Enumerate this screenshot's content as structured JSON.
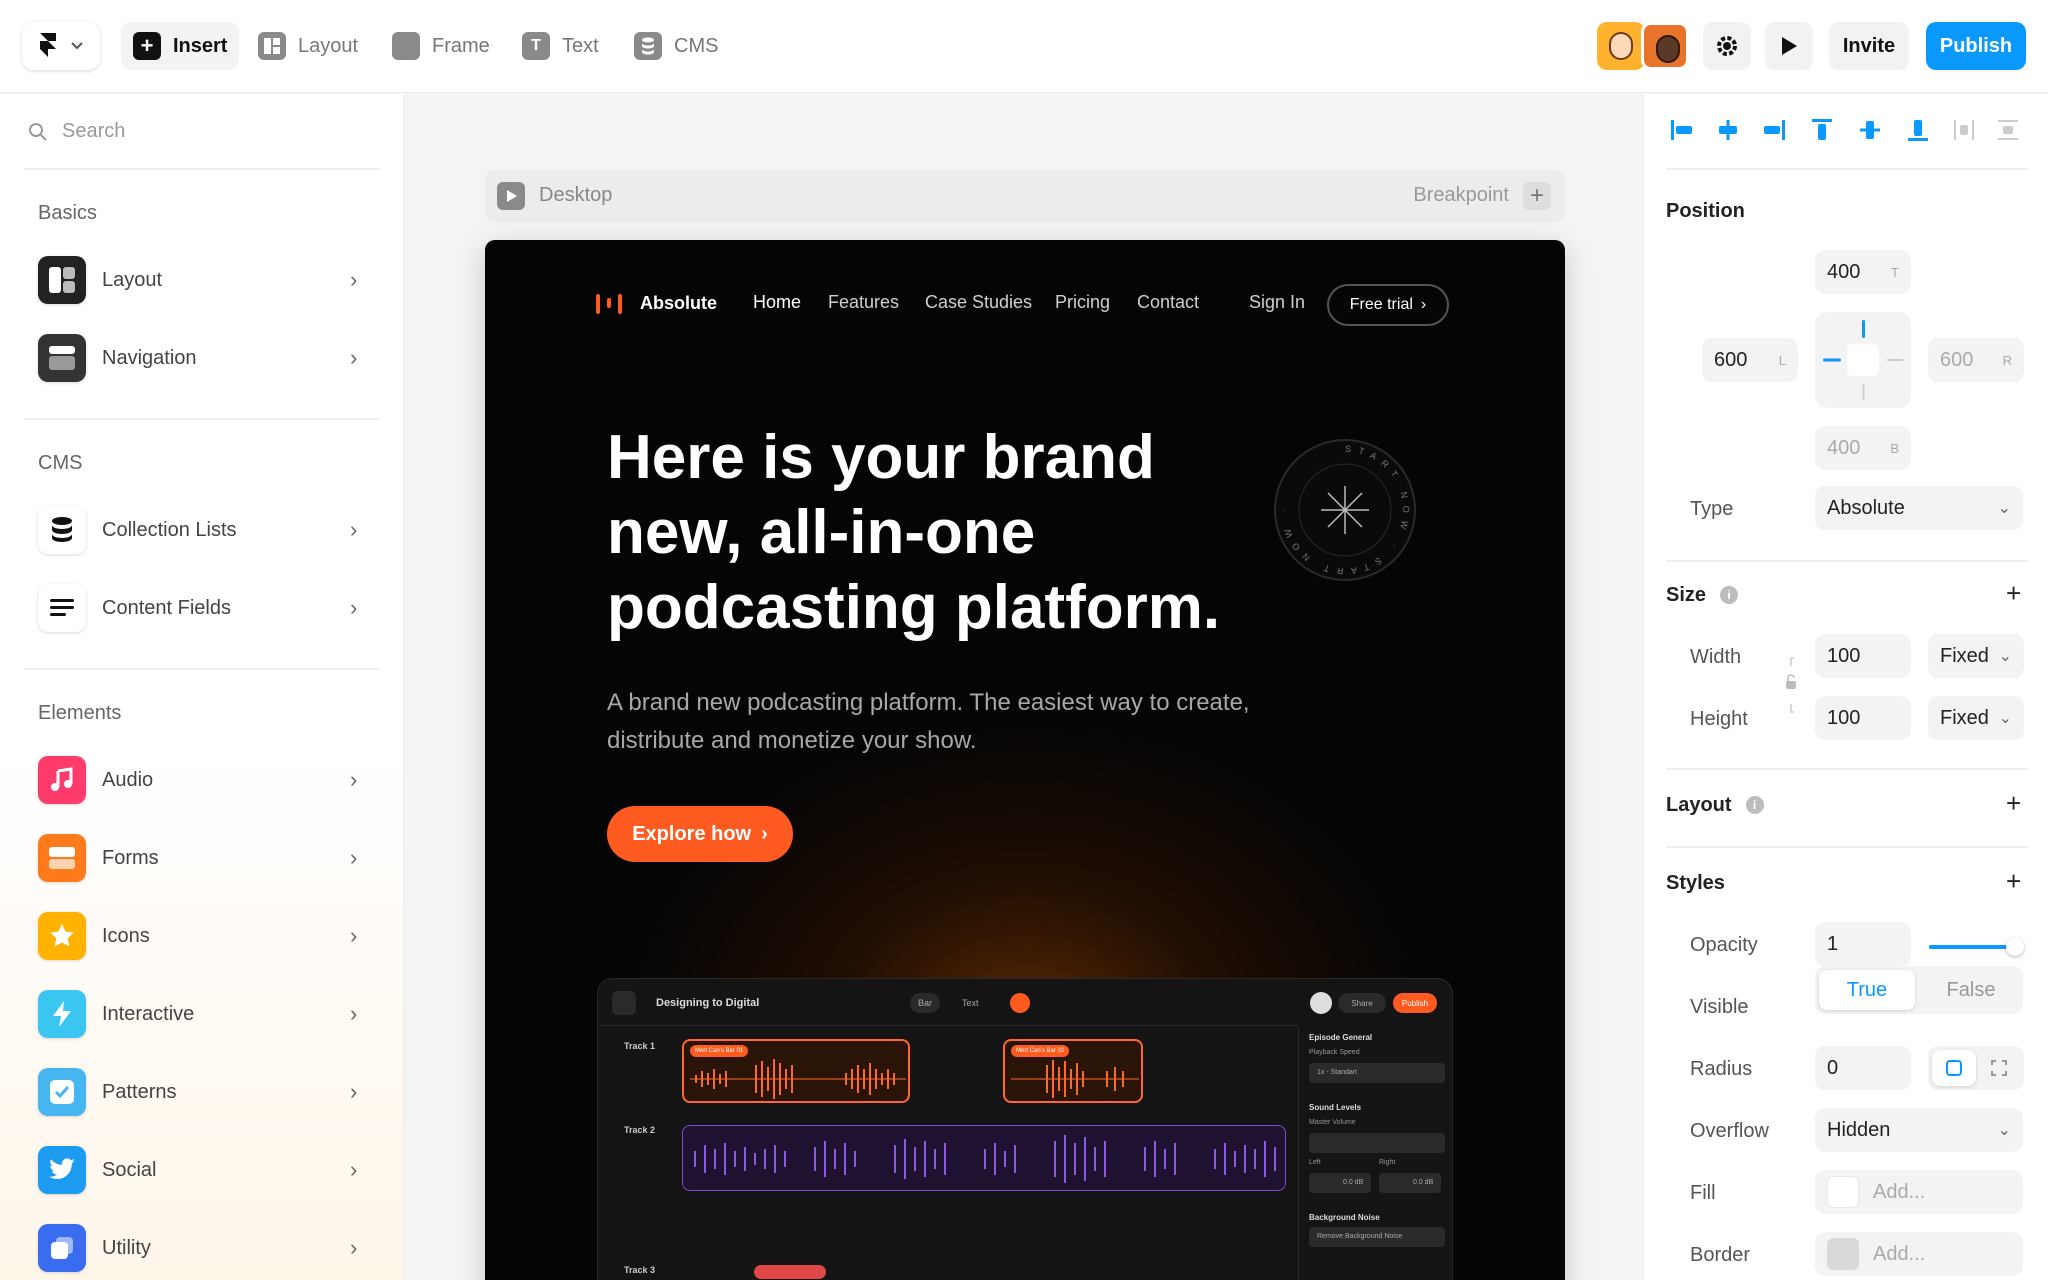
{
  "toolbar": {
    "tools": [
      {
        "label": "Insert",
        "icon": "plus-icon"
      },
      {
        "label": "Layout",
        "icon": "layout-icon"
      },
      {
        "label": "Frame",
        "icon": "frame-icon"
      },
      {
        "label": "Text",
        "icon": "text-icon"
      },
      {
        "label": "CMS",
        "icon": "database-icon"
      }
    ],
    "invite_label": "Invite",
    "publish_label": "Publish",
    "accent": "#0a99ff"
  },
  "left_panel": {
    "search_placeholder": "Search",
    "sections": [
      {
        "title": "Basics",
        "items": [
          {
            "label": "Layout",
            "icon": "layout-icon"
          },
          {
            "label": "Navigation",
            "icon": "navigation-icon"
          }
        ]
      },
      {
        "title": "CMS",
        "items": [
          {
            "label": "Collection Lists",
            "icon": "database-icon"
          },
          {
            "label": "Content Fields",
            "icon": "lines-icon"
          }
        ]
      },
      {
        "title": "Elements",
        "items": [
          {
            "label": "Audio",
            "icon": "music-note-icon",
            "color": "#ff3b6b"
          },
          {
            "label": "Forms",
            "icon": "form-icon",
            "color": "#ff7a1a"
          },
          {
            "label": "Icons",
            "icon": "star-icon",
            "color": "#ffb300"
          },
          {
            "label": "Interactive",
            "icon": "bolt-icon",
            "color": "#3ac6f0"
          },
          {
            "label": "Patterns",
            "icon": "checkbox-icon",
            "color": "#46b5f0"
          },
          {
            "label": "Social",
            "icon": "twitter-icon",
            "color": "#1d9bf0"
          },
          {
            "label": "Utility",
            "icon": "utility-icon",
            "color": "#3a6cf0"
          }
        ]
      }
    ]
  },
  "canvas": {
    "breakpoint_label": "Desktop",
    "breakpoint_right": "Breakpoint",
    "site": {
      "brand": "Absolute",
      "nav": [
        "Home",
        "Features",
        "Case Studies",
        "Pricing",
        "Contact"
      ],
      "sign_in": "Sign In",
      "free_trial": "Free trial",
      "hero_title": "Here is your brand new, all-in-one podcasting platform.",
      "hero_subtitle": "A brand new podcasting platform. The easiest way to create, distribute  and monetize your show.",
      "cta": "Explore how",
      "badge_text": "START NOW · START NOW ·",
      "accent": "#ff5a1f",
      "mock": {
        "title": "Designing to Digital",
        "tools": [
          "Bar",
          "Text"
        ],
        "share": "Share",
        "publish": "Publish",
        "tracks": [
          "Track 1",
          "Track 2",
          "Track 3"
        ],
        "clip_tags": [
          "Mert Can's Bar 01",
          "Mert Can's Bar 02"
        ],
        "side": {
          "episode": "Episode General",
          "playback_speed": "Playback Speed",
          "speed_value": "1x - Standart",
          "sound_levels": "Sound Levels",
          "master_volume": "Master Volume",
          "left": "Left",
          "right": "Right",
          "left_value": "0.0 dB",
          "right_value": "0.0 dB",
          "background_noise": "Background Noise",
          "remove_noise": "Remove Background Noise"
        }
      }
    }
  },
  "right_panel": {
    "position": {
      "title": "Position",
      "top": "400",
      "top_sfx": "T",
      "left": "600",
      "left_sfx": "L",
      "right": "600",
      "right_sfx": "R",
      "bottom": "400",
      "bottom_sfx": "B",
      "type_label": "Type",
      "type_value": "Absolute"
    },
    "size": {
      "title": "Size",
      "width_label": "Width",
      "width_value": "100",
      "width_mode": "Fixed",
      "height_label": "Height",
      "height_value": "100",
      "height_mode": "Fixed"
    },
    "layout": {
      "title": "Layout"
    },
    "styles": {
      "title": "Styles",
      "opacity_label": "Opacity",
      "opacity_value": "1",
      "opacity_level": 1.0,
      "visible_label": "Visible",
      "visible_true": "True",
      "visible_false": "False",
      "radius_label": "Radius",
      "radius_value": "0",
      "overflow_label": "Overflow",
      "overflow_value": "Hidden",
      "fill_label": "Fill",
      "fill_placeholder": "Add...",
      "border_label": "Border",
      "border_placeholder": "Add..."
    }
  }
}
